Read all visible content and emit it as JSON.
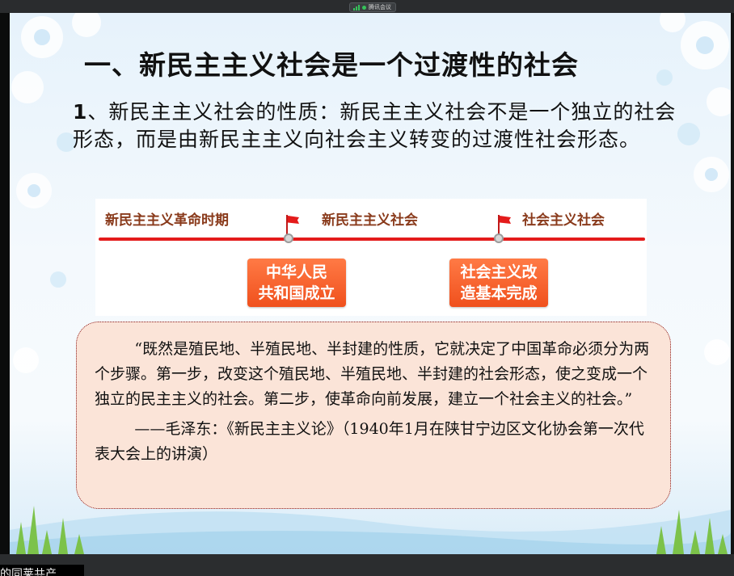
{
  "meeting": {
    "label": "腾讯会议",
    "status_color": "#36c25a"
  },
  "slide": {
    "title": "一、新民主主义社会是一个过渡性的社会",
    "intro_number": "1",
    "intro_text": "、新民主主义社会的性质：新民主主义社会不是一个独立的社会形态，而是由新民主主义向社会主义转变的过渡性社会形态。",
    "timeline": {
      "periods": [
        "新民主主义革命时期",
        "新民主主义社会",
        "社会主义社会"
      ],
      "events": [
        "中华人民\n共和国成立",
        "社会主义改\n造基本完成"
      ],
      "line_color": "#e41b1b",
      "event_color": "#f0501d"
    },
    "quote": {
      "text": "“既然是殖民地、半殖民地、半封建的性质，它就决定了中国革命必须分为两个步骤。第一步，改变这个殖民地、半殖民地、半封建的社会形态，使之变成一个独立的民主主义的社会。第二步，使革命向前发展，建立一个社会主义的社会。”",
      "source": "——毛泽东：《新民主主义论》（1940年1月在陕甘宁边区文化协会第一次代表大会上的讲演）"
    }
  },
  "participant": {
    "name_partial": "的同莱共产"
  }
}
